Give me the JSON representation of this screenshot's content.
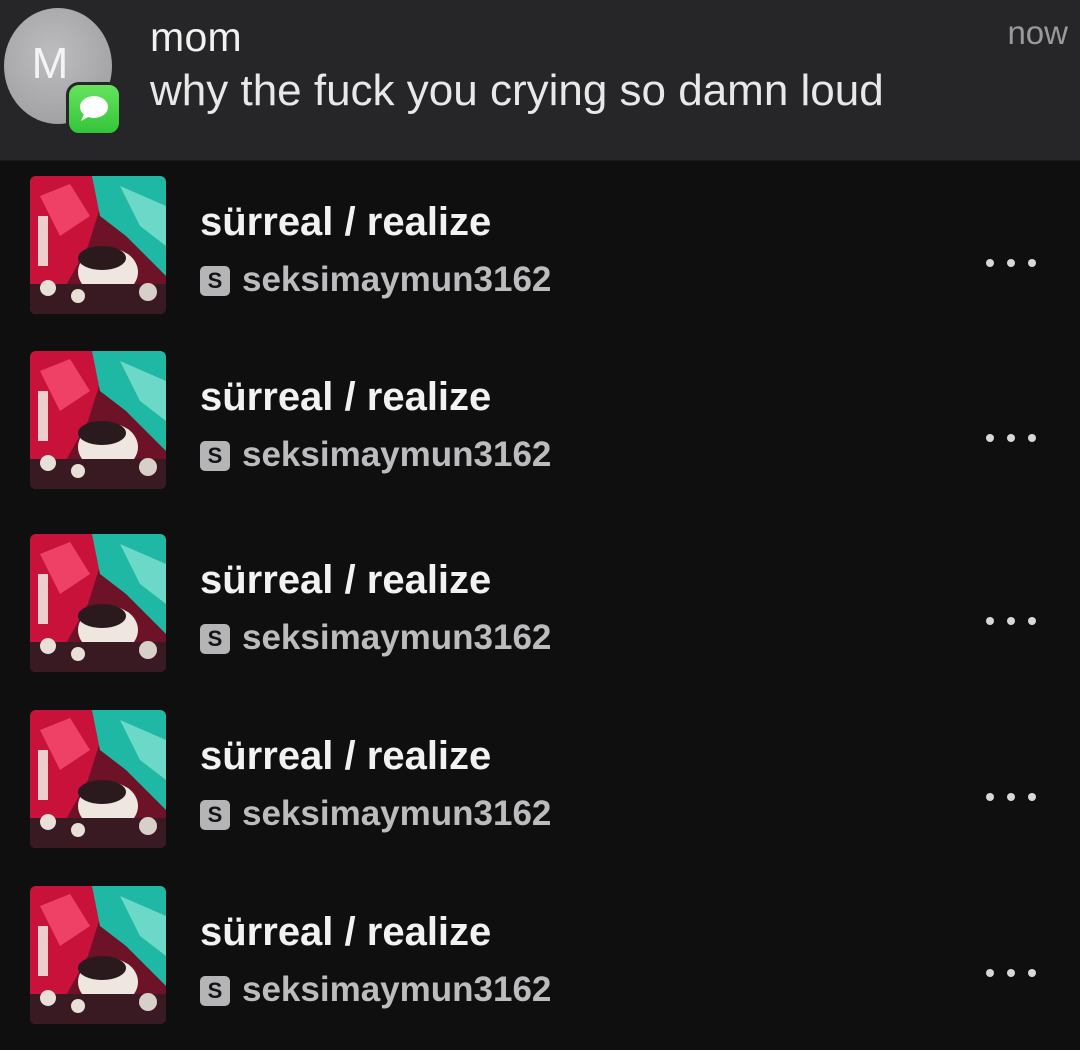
{
  "notification": {
    "avatar_initial": "M",
    "app_icon": "messages-icon",
    "sender": "mom",
    "message": "why the fuck you crying so damn loud",
    "time": "now"
  },
  "tracks": [
    {
      "title": "sürreal / realize",
      "source_badge": "S",
      "artist": "seksimaymun3162",
      "menu_icon": "more-options-icon"
    },
    {
      "title": "sürreal / realize",
      "source_badge": "S",
      "artist": "seksimaymun3162",
      "menu_icon": "more-options-icon"
    },
    {
      "title": "sürreal / realize",
      "source_badge": "S",
      "artist": "seksimaymun3162",
      "menu_icon": "more-options-icon"
    },
    {
      "title": "sürreal / realize",
      "source_badge": "S",
      "artist": "seksimaymun3162",
      "menu_icon": "more-options-icon"
    },
    {
      "title": "sürreal / realize",
      "source_badge": "S",
      "artist": "seksimaymun3162",
      "menu_icon": "more-options-icon"
    }
  ],
  "colors": {
    "background": "#0f0f10",
    "banner": "#262628",
    "messages_green": "#34c43a",
    "cover_red": "#c8123a",
    "cover_teal": "#1fb8a4"
  }
}
